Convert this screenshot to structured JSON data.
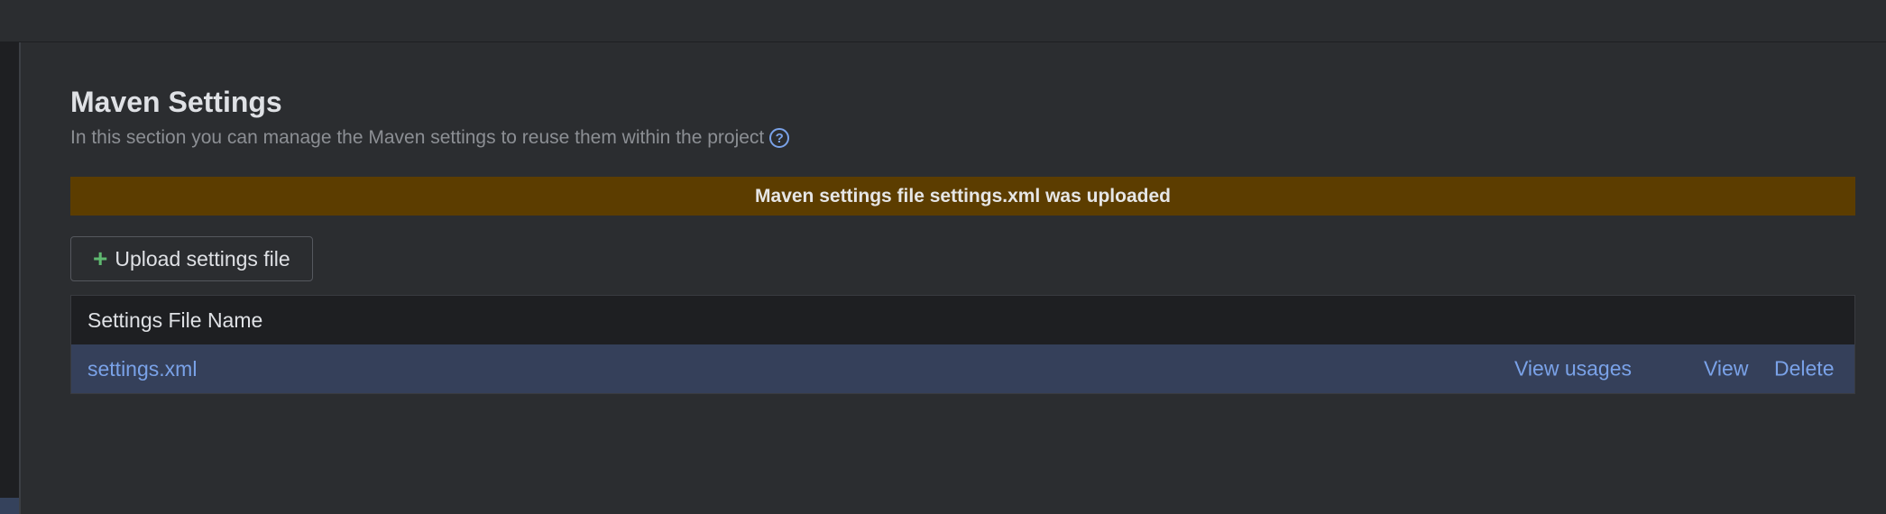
{
  "page": {
    "title": "Maven Settings",
    "subtitle": "In this section you can manage the Maven settings to reuse them within the project",
    "help_icon": "question-circle-icon"
  },
  "banner": {
    "message": "Maven settings file settings.xml was uploaded",
    "color": "#5c3d00"
  },
  "upload": {
    "label": "Upload settings file",
    "icon": "plus-icon",
    "icon_color": "#5fb870"
  },
  "table": {
    "columns": [
      "Settings File Name"
    ],
    "rows": [
      {
        "name": "settings.xml",
        "actions": {
          "usages": "View usages",
          "view": "View",
          "delete": "Delete"
        }
      }
    ]
  },
  "colors": {
    "background": "#2b2d30",
    "link": "#7aa2e8",
    "selected_row": "#35405a"
  }
}
